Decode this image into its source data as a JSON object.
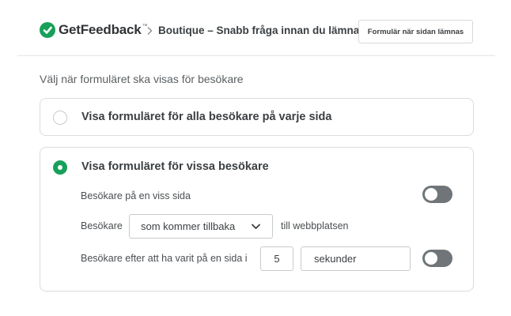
{
  "header": {
    "logo_text": "GetFeedback",
    "logo_tm": "™",
    "logo_icon": "getfeedback-logo-icon",
    "breadcrumb_separator_icon": "chevron-right-icon",
    "breadcrumb": "Boutique – Snabb fråga innan du lämnar",
    "trigger_button_label": "Formulär när sidan lämnas"
  },
  "section_label": "Välj när formuläret ska visas för besökare",
  "options": [
    {
      "label": "Visa formuläret för alla besökare på varje sida",
      "selected": false
    },
    {
      "label": "Visa formuläret för vissa besökare",
      "selected": true
    }
  ],
  "rules": {
    "specific_page": {
      "label": "Besökare på en viss sida",
      "enabled": false
    },
    "returning": {
      "prefix": "Besökare",
      "selected_option": "som kommer tillbaka",
      "suffix": "till webbplatsen",
      "caret_icon": "chevron-down-icon"
    },
    "time_on_page": {
      "label": "Besökare efter att ha varit på en sida i",
      "amount": "5",
      "unit": "sekunder",
      "enabled": false
    }
  },
  "colors": {
    "accent_green": "#18a05a",
    "toggle_off": "#6f7578",
    "border": "#d9dcde"
  }
}
